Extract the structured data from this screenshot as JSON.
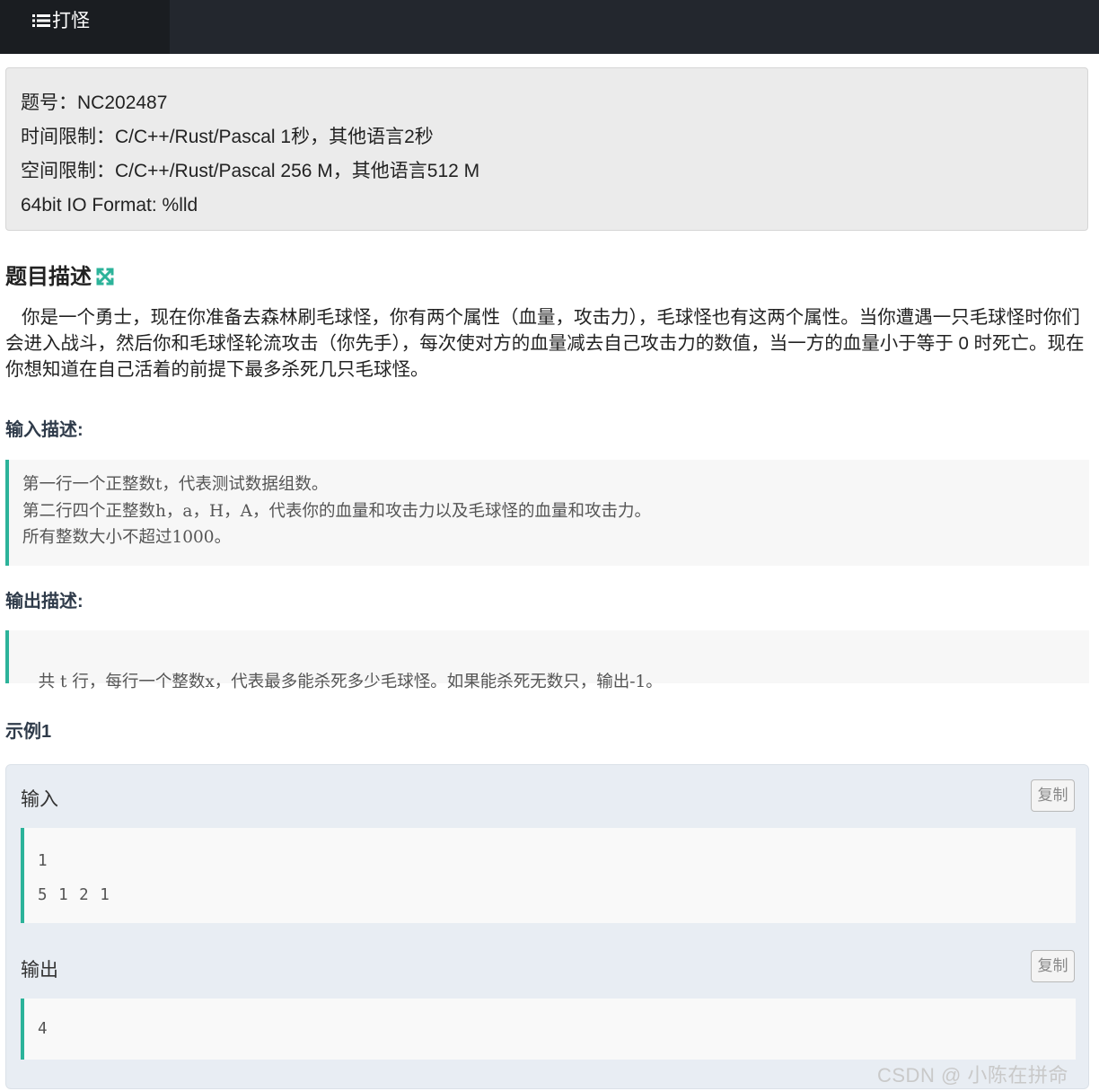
{
  "header": {
    "tab_label": "打怪",
    "tab_icon": "list-icon"
  },
  "info": {
    "problem_id": "题号：NC202487",
    "time_limit": "时间限制：C/C++/Rust/Pascal 1秒，其他语言2秒",
    "memory_limit": "空间限制：C/C++/Rust/Pascal 256 M，其他语言512 M",
    "io_format": "64bit IO Format: %lld"
  },
  "description": {
    "heading": "题目描述",
    "heading_icon": "expand-icon",
    "text": "你是一个勇士，现在你准备去森林刷毛球怪，你有两个属性（血量，攻击力），毛球怪也有这两个属性。当你遭遇一只毛球怪时你们会进入战斗，然后你和毛球怪轮流攻击（你先手），每次使对方的血量减去自己攻击力的数值，当一方的血量小于等于 0 时死亡。现在你想知道在自己活着的前提下最多杀死几只毛球怪。"
  },
  "input_desc": {
    "heading": "输入描述:",
    "lines": [
      "第一行一个正整数t，代表测试数据组数。",
      "第二行四个正整数h，a，H，A，代表你的血量和攻击力以及毛球怪的血量和攻击力。",
      "所有整数大小不超过1000。"
    ]
  },
  "output_desc": {
    "heading": "输出描述:",
    "text": " 共 t 行，每行一个整数x，代表最多能杀死多少毛球怪。如果能杀死无数只，输出-1。"
  },
  "example": {
    "heading": "示例1",
    "input_label": "输入",
    "output_label": "输出",
    "copy_label": "复制",
    "input_lines": [
      "1",
      "5 1 2 1"
    ],
    "output_lines": [
      "4"
    ]
  },
  "watermark": "CSDN @ 小陈在拼命",
  "colors": {
    "accent": "#2cb39a",
    "topbar": "#23272e",
    "tab": "#1a1d21",
    "sample_bg": "#e8edf3"
  }
}
